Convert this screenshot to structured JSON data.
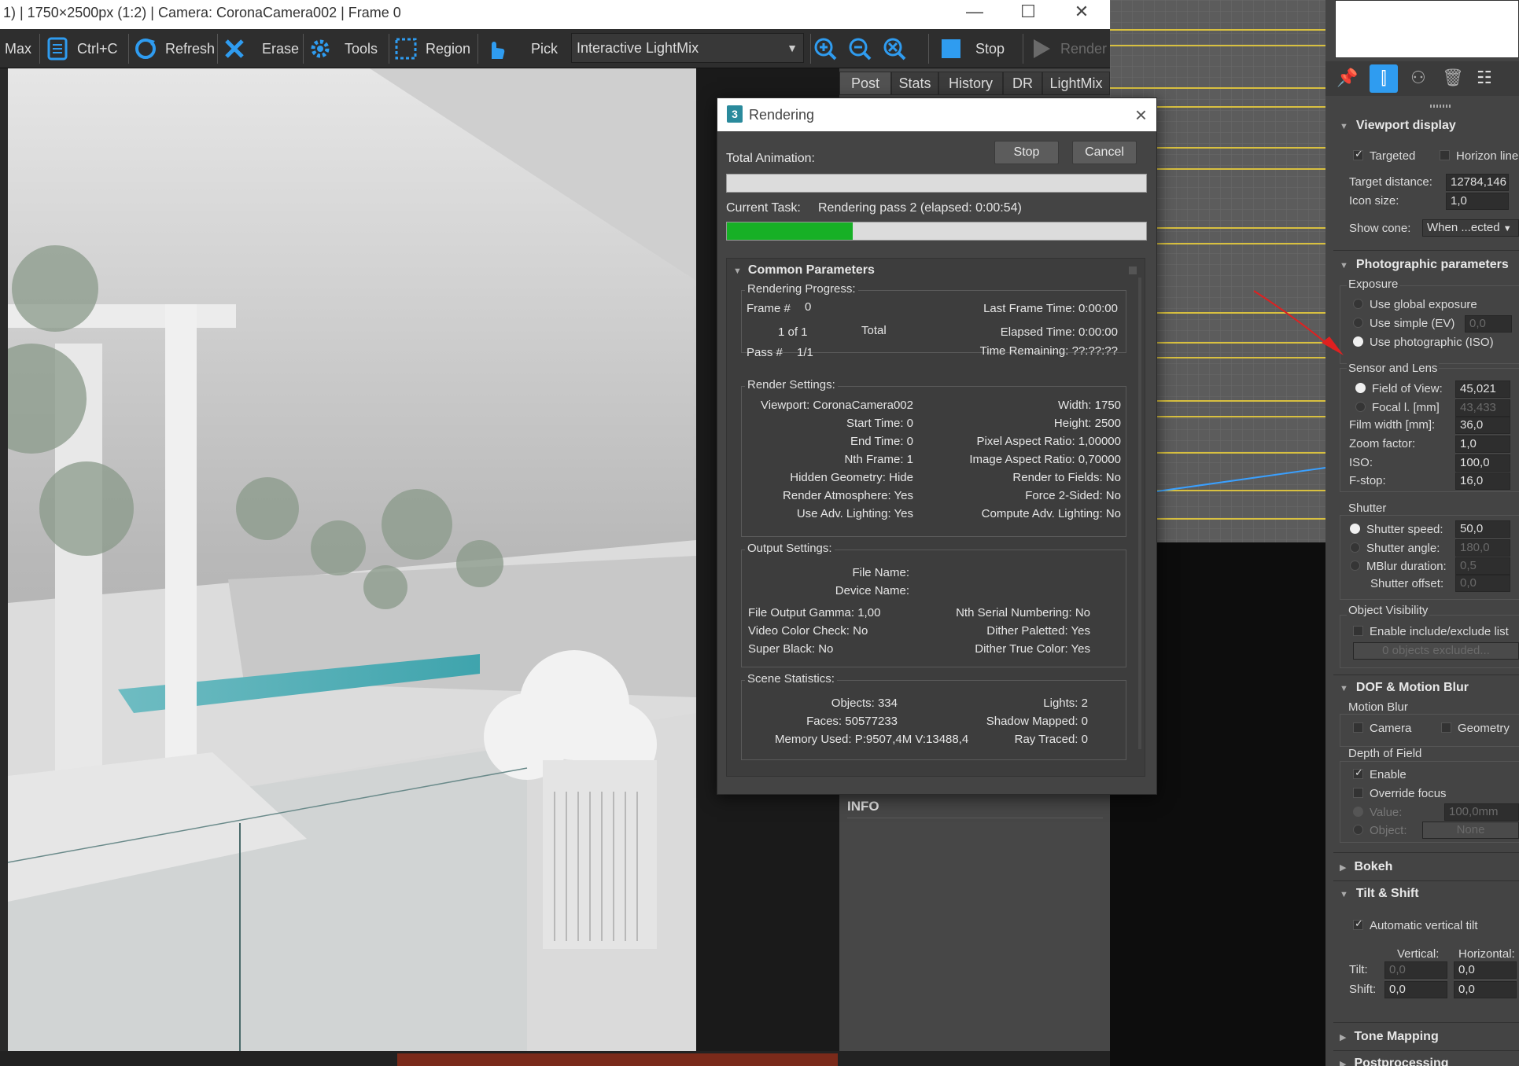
{
  "vfb": {
    "title": "1) | 1750×2500px (1:2) | Camera: CoronaCamera002 | Frame 0",
    "toolbar": {
      "max": "Max",
      "copy": "Ctrl+C",
      "refresh": "Refresh",
      "erase": "Erase",
      "tools": "Tools",
      "region": "Region",
      "pick": "Pick",
      "lightmix": "Interactive LightMix",
      "stop": "Stop",
      "render": "Render"
    },
    "tabs": [
      "Post",
      "Stats",
      "History",
      "DR",
      "LightMix"
    ],
    "info": "INFO"
  },
  "dialog": {
    "title": "Rendering",
    "total_animation_label": "Total Animation:",
    "stop": "Stop",
    "cancel": "Cancel",
    "current_task_label": "Current Task:",
    "current_task_value": "Rendering pass 2 (elapsed: 0:00:54)",
    "total_progress": 0,
    "task_progress": 0.3,
    "rollout_title": "Common Parameters",
    "progress": {
      "label": "Rendering Progress:",
      "frame_label": "Frame #",
      "frame_value": "0",
      "of_value": "1 of 1",
      "total": "Total",
      "pass_label": "Pass #",
      "pass_value": "1/1",
      "last_frame_time": "Last Frame Time:  0:00:00",
      "elapsed_time": "Elapsed Time:  0:00:00",
      "time_remaining": "Time Remaining: ??:??:??"
    },
    "render_settings": {
      "label": "Render Settings:",
      "left": [
        "Viewport: CoronaCamera002",
        "Start Time: 0",
        "End Time: 0",
        "Nth Frame: 1",
        "Hidden Geometry: Hide",
        "Render Atmosphere: Yes",
        "Use Adv. Lighting: Yes"
      ],
      "right": [
        "Width: 1750",
        "Height: 2500",
        "Pixel Aspect Ratio: 1,00000",
        "Image Aspect Ratio: 0,70000",
        "Render to Fields: No",
        "Force 2-Sided: No",
        "Compute Adv. Lighting: No"
      ]
    },
    "output_settings": {
      "label": "Output Settings:",
      "file_name": "File Name:",
      "device_name": "Device Name:",
      "left": [
        "File Output Gamma: 1,00",
        "Video Color Check: No",
        "Super Black: No"
      ],
      "right": [
        "Nth Serial Numbering: No",
        "Dither Paletted: Yes",
        "Dither True Color: Yes"
      ]
    },
    "scene_statistics": {
      "label": "Scene Statistics:",
      "objects": "Objects:  334",
      "faces": "Faces:  50577233",
      "memory": "Memory Used:  P:9507,4M V:13488,4",
      "lights": "Lights: 2",
      "shadow_mapped": "Shadow Mapped: 0",
      "ray_traced": "Ray Traced: 0"
    }
  },
  "command_panel": {
    "viewport_display": {
      "title": "Viewport display",
      "targeted": "Targeted",
      "targeted_checked": true,
      "horizon": "Horizon line",
      "target_distance_label": "Target distance:",
      "target_distance": "12784,146",
      "icon_size_label": "Icon size:",
      "icon_size": "1,0",
      "show_cone_label": "Show cone:",
      "show_cone": "When ...ected"
    },
    "photographic": {
      "title": "Photographic parameters",
      "exposure": "Exposure",
      "use_global": "Use global exposure",
      "use_simple": "Use simple (EV)",
      "simple_value": "0,0",
      "use_photographic": "Use photographic (ISO)",
      "sensor_and_lens": "Sensor and Lens",
      "fov_label": "Field of View:",
      "fov": "45,021",
      "focal_label": "Focal l. [mm]",
      "focal": "43,433",
      "film_width_label": "Film width [mm]:",
      "film_width": "36,0",
      "zoom_label": "Zoom factor:",
      "zoom": "1,0",
      "iso_label": "ISO:",
      "iso": "100,0",
      "fstop_label": "F-stop:",
      "fstop": "16,0",
      "shutter": "Shutter",
      "shutter_speed_label": "Shutter speed:",
      "shutter_speed": "50,0",
      "shutter_angle_label": "Shutter angle:",
      "shutter_angle": "180,0",
      "mblur_label": "MBlur duration:",
      "mblur": "0,5",
      "shutter_offset_label": "Shutter offset:",
      "shutter_offset": "0,0",
      "object_visibility": "Object Visibility",
      "enable_list": "Enable include/exclude list",
      "objects_excluded": "0 objects excluded..."
    },
    "dof": {
      "title": "DOF & Motion Blur",
      "motion_blur": "Motion Blur",
      "camera": "Camera",
      "geometry": "Geometry",
      "depth_of_field": "Depth of Field",
      "enable": "Enable",
      "override_focus": "Override focus",
      "value_label": "Value:",
      "value": "100,0mm",
      "object_label": "Object:",
      "object": "None"
    },
    "bokeh": {
      "title": "Bokeh"
    },
    "tilt": {
      "title": "Tilt & Shift",
      "auto_vertical": "Automatic vertical tilt",
      "vertical": "Vertical:",
      "horizontal": "Horizontal:",
      "tilt_label": "Tilt:",
      "tilt_v": "0,0",
      "tilt_h": "0,0",
      "shift_label": "Shift:",
      "shift_v": "0,0",
      "shift_h": "0,0"
    },
    "tone_mapping": {
      "title": "Tone Mapping"
    },
    "postprocessing": {
      "title": "Postprocessing"
    }
  }
}
